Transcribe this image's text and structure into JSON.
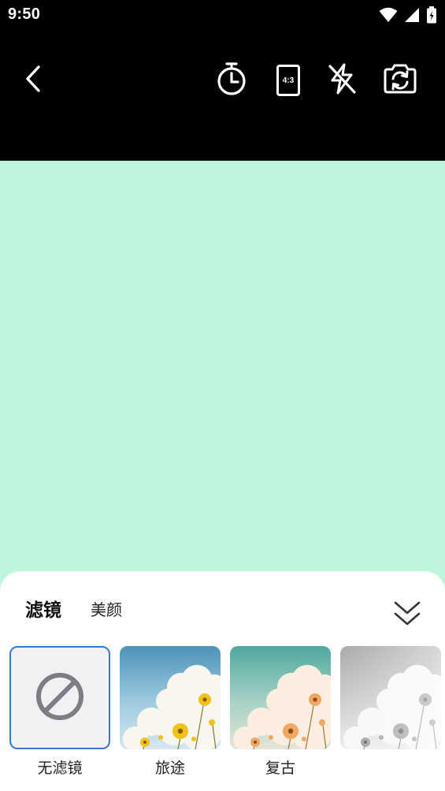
{
  "status_bar": {
    "time": "9:50",
    "icons": [
      "wifi-icon",
      "signal-icon",
      "battery-icon"
    ]
  },
  "top_bar": {
    "back_icon": "chevron-left-icon",
    "timer_icon": "timer-icon",
    "aspect_ratio_label": "4:3",
    "flash_icon": "flash-off-icon",
    "switch_camera_icon": "camera-switch-icon"
  },
  "preview": {
    "background_color": "#c0f5dd"
  },
  "panel": {
    "tabs": [
      {
        "label": "滤镜",
        "active": true
      },
      {
        "label": "美颜",
        "active": false
      }
    ],
    "collapse_icon": "double-chevron-down-icon",
    "filters": [
      {
        "label": "无滤镜",
        "selected": true,
        "icon": "no-filter-icon"
      },
      {
        "label": "旅途",
        "selected": false,
        "style": "travel"
      },
      {
        "label": "复古",
        "selected": false,
        "style": "retro"
      },
      {
        "label": "",
        "selected": false,
        "style": "mono"
      }
    ]
  },
  "colors": {
    "accent": "#3578d4",
    "preview_bg": "#c0f5dd"
  }
}
